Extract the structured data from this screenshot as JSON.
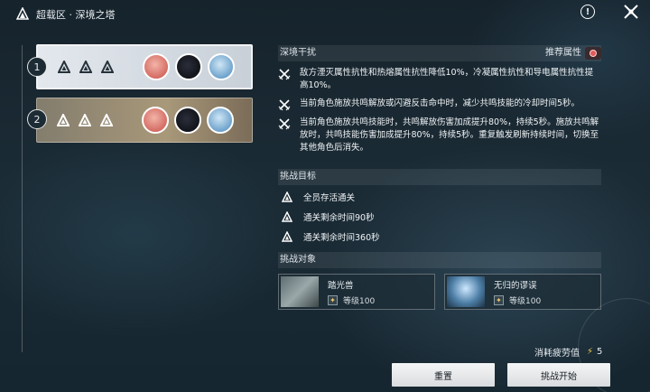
{
  "header": {
    "breadcrumb": "超载区 · 深境之塔"
  },
  "levels": [
    {
      "number": "1"
    },
    {
      "number": "2"
    }
  ],
  "disturbance": {
    "title": "深境干扰",
    "recommend_label": "推荐属性",
    "effects": [
      "敌方湮灭属性抗性和热熔属性抗性降低10%，冷凝属性抗性和导电属性抗性提高10%。",
      "当前角色施放共鸣解放或闪避反击命中时，减少共鸣技能的冷却时间5秒。",
      "当前角色施放共鸣技能时，共鸣解放伤害加成提升80%，持续5秒。施放共鸣解放时，共鸣技能伤害加成提升80%，持续5秒。重复触发刷新持续时间，切换至其他角色后消失。"
    ]
  },
  "objectives": {
    "title": "挑战目标",
    "items": [
      "全员存活通关",
      "通关剩余时间90秒",
      "通关剩余时间360秒"
    ]
  },
  "enemies": {
    "title": "挑战对象",
    "items": [
      {
        "name": "踏光兽",
        "level": "等级100"
      },
      {
        "name": "无归的谬误",
        "level": "等级100"
      }
    ]
  },
  "fatigue": {
    "label": "消耗疲劳值",
    "value": "5"
  },
  "buttons": {
    "reset": "重置",
    "start": "挑战开始"
  },
  "colors": {
    "accent": "#f2c94c",
    "attribute": "#e25a5a"
  }
}
